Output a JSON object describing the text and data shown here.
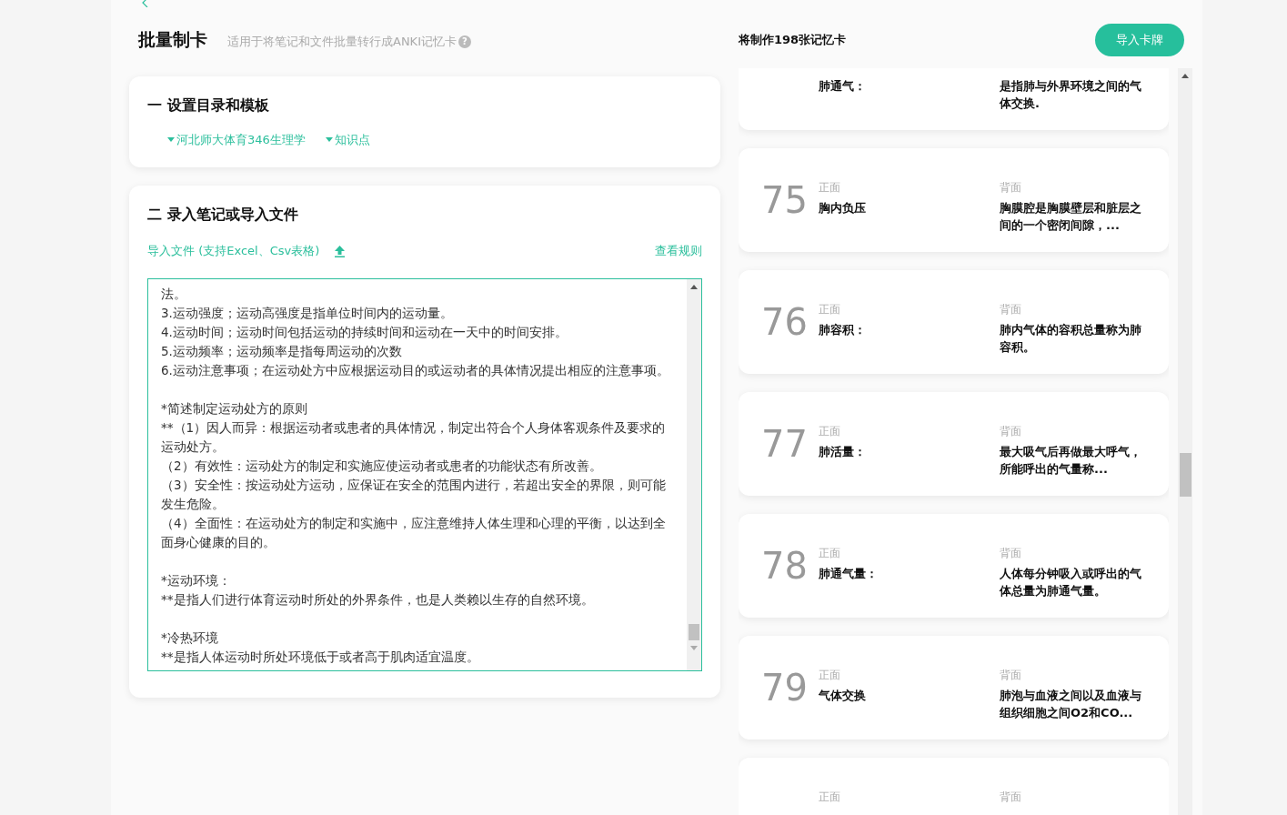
{
  "header": {
    "title": "批量制卡",
    "subtitle": "适用于将笔记和文件批量转行成ANKI记忆卡",
    "help_icon": "?",
    "card_count": "将制作198张记忆卡",
    "import_button": "导入卡牌"
  },
  "section_template": {
    "title": "一 设置目录和模板",
    "dropdowns": [
      "河北师大体育346生理学",
      "知识点"
    ]
  },
  "section_notes": {
    "title": "二 录入笔记或导入文件",
    "import_link": "导入文件 (支持Excel、Csv表格)",
    "rules_link": "查看规则",
    "paragraphs": [
      [
        "法。",
        "3.运动强度；运动高强度是指单位时间内的运动量。",
        "4.运动时间；运动时间包括运动的持续时间和运动在一天中的时间安排。",
        "5.运动频率；运动频率是指每周运动的次数",
        "6.运动注意事项；在运动处方中应根据运动目的或运动者的具体情况提出相应的注意事项。"
      ],
      [
        "*简述制定运动处方的原则",
        "**（1）因人而异：根据运动者或患者的具体情况，制定出符合个人身体客观条件及要求的运动处方。",
        "（2）有效性：运动处方的制定和实施应使运动者或患者的功能状态有所改善。",
        "（3）安全性：按运动处方运动，应保证在安全的范围内进行，若超出安全的界限，则可能发生危险。",
        "（4）全面性：在运动处方的制定和实施中，应注意维持人体生理和心理的平衡，以达到全面身心健康的目的。"
      ],
      [
        "*运动环境：",
        "**是指人们进行体育运动时所处的外界条件，也是人类赖以生存的自然环境。"
      ],
      [
        "*冷热环境",
        "**是指人体运动时所处环境低于或者高于肌肉适宜温度。"
      ]
    ]
  },
  "cards": [
    {
      "front": "肺通气：",
      "back": "是指肺与外界环境之间的气体交换."
    },
    {
      "number": "75",
      "front_label": "正面",
      "back_label": "背面",
      "front": "胸内负压",
      "back": "胸膜腔是胸膜壁层和脏层之间的一个密闭间隙，..."
    },
    {
      "number": "76",
      "front_label": "正面",
      "back_label": "背面",
      "front": "肺容积：",
      "back": "肺内气体的容积总量称为肺容积。"
    },
    {
      "number": "77",
      "front_label": "正面",
      "back_label": "背面",
      "front": "肺活量：",
      "back": "最大吸气后再做最大呼气，所能呼出的气量称..."
    },
    {
      "number": "78",
      "front_label": "正面",
      "back_label": "背面",
      "front": "肺通气量：",
      "back": "人体每分钟吸入或呼出的气体总量为肺通气量。"
    },
    {
      "number": "79",
      "front_label": "正面",
      "back_label": "背面",
      "front": "气体交换",
      "back": "肺泡与血液之间以及血液与组织细胞之间O2和CO..."
    },
    {
      "front_label": "正面",
      "back_label": "背面"
    }
  ]
}
